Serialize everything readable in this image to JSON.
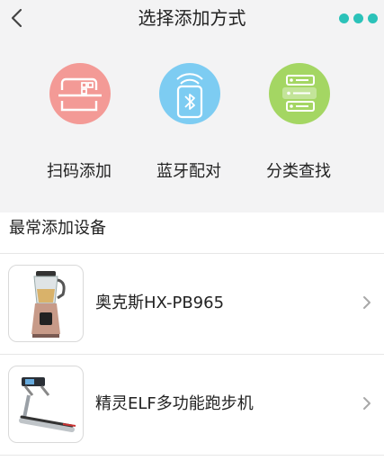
{
  "header": {
    "title": "选择添加方式"
  },
  "methods": [
    {
      "label": "扫码添加",
      "icon": "qr-scan-icon",
      "color": "#f08a86"
    },
    {
      "label": "蓝牙配对",
      "icon": "bluetooth-icon",
      "color": "#6cc6f0"
    },
    {
      "label": "分类查找",
      "icon": "category-list-icon",
      "color": "#9fd35b"
    }
  ],
  "frequent": {
    "title": "最常添加设备",
    "devices": [
      {
        "name": "奥克斯HX-PB965",
        "icon": "blender-icon"
      },
      {
        "name": "精灵ELF多功能跑步机",
        "icon": "treadmill-icon"
      }
    ]
  },
  "colors": {
    "accent": "#2bc2b9",
    "header_bg": "#f3f3f4"
  }
}
